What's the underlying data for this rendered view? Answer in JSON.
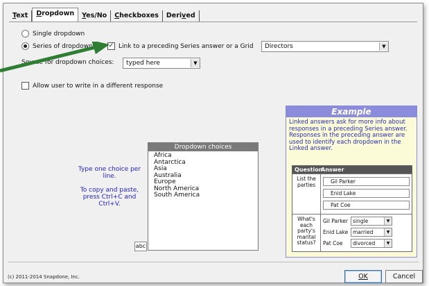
{
  "tabs": [
    {
      "label": "Text",
      "ul": "T",
      "rest": "ext",
      "active": false
    },
    {
      "label": "Dropdown",
      "ul": "D",
      "rest": "ropdown",
      "active": true
    },
    {
      "label": "Yes/No",
      "ul": "Y",
      "rest": "es/No",
      "active": false
    },
    {
      "label": "Checkboxes",
      "ul": "C",
      "rest": "heckboxes",
      "active": false
    },
    {
      "label": "Derived",
      "pre": "Deri",
      "ul": "v",
      "rest": "ed",
      "active": false
    }
  ],
  "options": {
    "single_dropdown": "Single dropdown",
    "series_of_dropdowns": "Series of dropdowns",
    "link_label": "Link to a preceding Series answer or a Grid",
    "link_value": "Directors",
    "source_label": "Source for dropdown choices:",
    "source_value": "typed here",
    "allow_write_in": "Allow user to write in a different response"
  },
  "choices": {
    "header": "Dropdown choices",
    "items": [
      "Africa",
      "Antarctica",
      "Asia",
      "Australia",
      "Europe",
      "North America",
      "South America"
    ],
    "hint_line1": "Type one choice per line.",
    "hint_line2": "To copy and paste, press Ctrl+C and Ctrl+V.",
    "abc_button": "abc"
  },
  "example": {
    "title": "Example",
    "description": "Linked answers ask for more info about responses in a preceding Series answer.  Responses in the preceding answer are used to identify each dropdown in the Linked answer.",
    "col_question": "Question",
    "col_answer": "Answer",
    "q1": "List the parties",
    "parties": [
      "Gil Parker",
      "Enid Lake",
      "Pat Coe"
    ],
    "q2": "What's each party's marital status?",
    "statuses": [
      {
        "name": "Gil Parker",
        "value": "single"
      },
      {
        "name": "Enid Lake",
        "value": "married"
      },
      {
        "name": "Pat Coe",
        "value": "divorced"
      }
    ]
  },
  "footer": {
    "copyright": "(c) 2011-2014 Snapdone, Inc.",
    "ok": "OK",
    "cancel": "Cancel"
  },
  "colors": {
    "arrow": "#2e7d32",
    "example_header": "#8c8cdc",
    "example_bg": "#fbfbd8",
    "hint_text": "#2222cc"
  }
}
